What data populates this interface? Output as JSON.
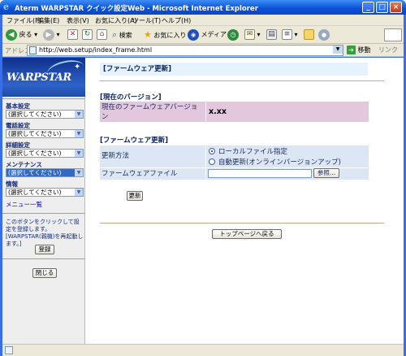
{
  "window": {
    "title": "Aterm WARPSTAR クイック設定Web - Microsoft Internet Explorer",
    "min_glyph": "_",
    "max_glyph": "□",
    "close_glyph": "×"
  },
  "menubar": [
    "ファイル(F)",
    "編集(E)",
    "表示(V)",
    "お気に入り(A)",
    "ツール(T)",
    "ヘルプ(H)"
  ],
  "toolbar": {
    "back": "戻る",
    "search": "検索",
    "favorites": "お気に入り",
    "media": "メディア"
  },
  "address": {
    "label": "アドレス(D)",
    "url": "http://web.setup/index_frame.html",
    "go": "移動",
    "links": "リンク »"
  },
  "sidebar": {
    "logo": "WARPSTAR",
    "sections": [
      {
        "caption": "基本設定",
        "value": "(選択してください)"
      },
      {
        "caption": "電話設定",
        "value": "(選択してください)"
      },
      {
        "caption": "詳細設定",
        "value": "(選択してください)"
      },
      {
        "caption": "メンテナンス",
        "value": "(選択してください)"
      },
      {
        "caption": "情報",
        "value": "(選択してください)"
      }
    ],
    "menu_list": "メニュー一覧",
    "note": "このボタンをクリックして設定を登録します。[WARPSTAR(親機)を再起動します。]",
    "register_button": "登録",
    "close_button": "閉じる"
  },
  "main": {
    "page_title": "[ファームウェア更新]",
    "current_version_heading": "[現在のバージョン]",
    "current_version_label": "現在のファームウェアバージョン",
    "current_version_value": "x.xx",
    "update_heading": "[ファームウェア更新]",
    "method_label": "更新方法",
    "method_options": [
      "ローカルファイル指定",
      "自動更新(オンラインバージョンアップ)"
    ],
    "method_selected": 0,
    "file_label": "ファームウェアファイル",
    "file_value": "",
    "browse_button": "参照...",
    "update_button": "更新",
    "top_page_button": "トップページへ戻る"
  },
  "colors": {
    "version_row": "#e3c7dd",
    "form_row": "#dde6f5",
    "title_bg": "#e6f3ff",
    "divider": "#c9a98c"
  }
}
